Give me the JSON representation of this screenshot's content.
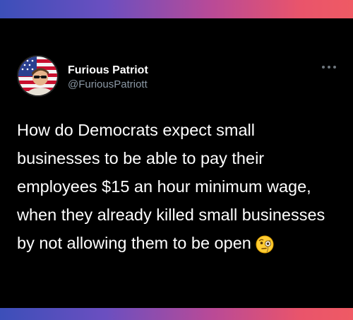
{
  "author": {
    "display_name": "Furious Patriot",
    "handle": "@FuriousPatriott",
    "avatar_icon": "flag-avatar-icon"
  },
  "tweet": {
    "text": "How do Democrats expect small businesses to be able to pay their employees $15 an hour minimum wage, when they already killed small businesses by not allowing them to be open",
    "emoji": "face-with-monocle-emoji"
  },
  "colors": {
    "background": "#000000",
    "gradient_start": "#3c4fb9",
    "gradient_end": "#ef5a64",
    "handle_gray": "#8b98a5"
  }
}
